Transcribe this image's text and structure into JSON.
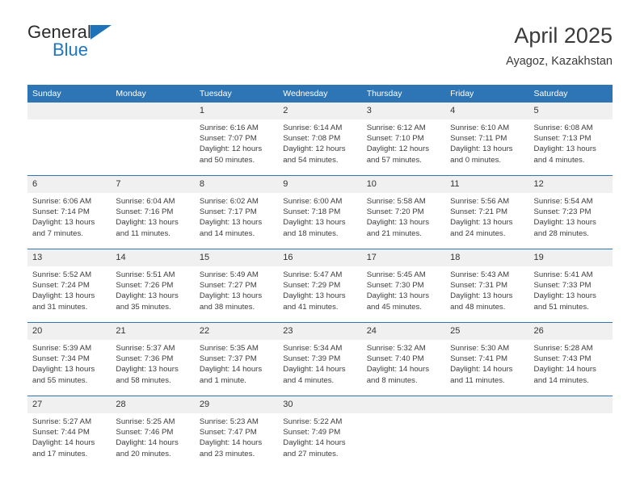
{
  "brand": {
    "line1": "General",
    "line2": "Blue",
    "triangle_color": "#1f72b8"
  },
  "header": {
    "title": "April 2025",
    "subtitle": "Ayagoz, Kazakhstan"
  },
  "theme": {
    "header_blue": "#2e75b6",
    "daynum_gray": "#f0f0f0",
    "text": "#333333"
  },
  "weekday_headers": [
    "Sunday",
    "Monday",
    "Tuesday",
    "Wednesday",
    "Thursday",
    "Friday",
    "Saturday"
  ],
  "weeks": [
    [
      {
        "day": "",
        "lines": []
      },
      {
        "day": "",
        "lines": []
      },
      {
        "day": "1",
        "lines": [
          "Sunrise: 6:16 AM",
          "Sunset: 7:07 PM",
          "Daylight: 12 hours",
          "and 50 minutes."
        ]
      },
      {
        "day": "2",
        "lines": [
          "Sunrise: 6:14 AM",
          "Sunset: 7:08 PM",
          "Daylight: 12 hours",
          "and 54 minutes."
        ]
      },
      {
        "day": "3",
        "lines": [
          "Sunrise: 6:12 AM",
          "Sunset: 7:10 PM",
          "Daylight: 12 hours",
          "and 57 minutes."
        ]
      },
      {
        "day": "4",
        "lines": [
          "Sunrise: 6:10 AM",
          "Sunset: 7:11 PM",
          "Daylight: 13 hours",
          "and 0 minutes."
        ]
      },
      {
        "day": "5",
        "lines": [
          "Sunrise: 6:08 AM",
          "Sunset: 7:13 PM",
          "Daylight: 13 hours",
          "and 4 minutes."
        ]
      }
    ],
    [
      {
        "day": "6",
        "lines": [
          "Sunrise: 6:06 AM",
          "Sunset: 7:14 PM",
          "Daylight: 13 hours",
          "and 7 minutes."
        ]
      },
      {
        "day": "7",
        "lines": [
          "Sunrise: 6:04 AM",
          "Sunset: 7:16 PM",
          "Daylight: 13 hours",
          "and 11 minutes."
        ]
      },
      {
        "day": "8",
        "lines": [
          "Sunrise: 6:02 AM",
          "Sunset: 7:17 PM",
          "Daylight: 13 hours",
          "and 14 minutes."
        ]
      },
      {
        "day": "9",
        "lines": [
          "Sunrise: 6:00 AM",
          "Sunset: 7:18 PM",
          "Daylight: 13 hours",
          "and 18 minutes."
        ]
      },
      {
        "day": "10",
        "lines": [
          "Sunrise: 5:58 AM",
          "Sunset: 7:20 PM",
          "Daylight: 13 hours",
          "and 21 minutes."
        ]
      },
      {
        "day": "11",
        "lines": [
          "Sunrise: 5:56 AM",
          "Sunset: 7:21 PM",
          "Daylight: 13 hours",
          "and 24 minutes."
        ]
      },
      {
        "day": "12",
        "lines": [
          "Sunrise: 5:54 AM",
          "Sunset: 7:23 PM",
          "Daylight: 13 hours",
          "and 28 minutes."
        ]
      }
    ],
    [
      {
        "day": "13",
        "lines": [
          "Sunrise: 5:52 AM",
          "Sunset: 7:24 PM",
          "Daylight: 13 hours",
          "and 31 minutes."
        ]
      },
      {
        "day": "14",
        "lines": [
          "Sunrise: 5:51 AM",
          "Sunset: 7:26 PM",
          "Daylight: 13 hours",
          "and 35 minutes."
        ]
      },
      {
        "day": "15",
        "lines": [
          "Sunrise: 5:49 AM",
          "Sunset: 7:27 PM",
          "Daylight: 13 hours",
          "and 38 minutes."
        ]
      },
      {
        "day": "16",
        "lines": [
          "Sunrise: 5:47 AM",
          "Sunset: 7:29 PM",
          "Daylight: 13 hours",
          "and 41 minutes."
        ]
      },
      {
        "day": "17",
        "lines": [
          "Sunrise: 5:45 AM",
          "Sunset: 7:30 PM",
          "Daylight: 13 hours",
          "and 45 minutes."
        ]
      },
      {
        "day": "18",
        "lines": [
          "Sunrise: 5:43 AM",
          "Sunset: 7:31 PM",
          "Daylight: 13 hours",
          "and 48 minutes."
        ]
      },
      {
        "day": "19",
        "lines": [
          "Sunrise: 5:41 AM",
          "Sunset: 7:33 PM",
          "Daylight: 13 hours",
          "and 51 minutes."
        ]
      }
    ],
    [
      {
        "day": "20",
        "lines": [
          "Sunrise: 5:39 AM",
          "Sunset: 7:34 PM",
          "Daylight: 13 hours",
          "and 55 minutes."
        ]
      },
      {
        "day": "21",
        "lines": [
          "Sunrise: 5:37 AM",
          "Sunset: 7:36 PM",
          "Daylight: 13 hours",
          "and 58 minutes."
        ]
      },
      {
        "day": "22",
        "lines": [
          "Sunrise: 5:35 AM",
          "Sunset: 7:37 PM",
          "Daylight: 14 hours",
          "and 1 minute."
        ]
      },
      {
        "day": "23",
        "lines": [
          "Sunrise: 5:34 AM",
          "Sunset: 7:39 PM",
          "Daylight: 14 hours",
          "and 4 minutes."
        ]
      },
      {
        "day": "24",
        "lines": [
          "Sunrise: 5:32 AM",
          "Sunset: 7:40 PM",
          "Daylight: 14 hours",
          "and 8 minutes."
        ]
      },
      {
        "day": "25",
        "lines": [
          "Sunrise: 5:30 AM",
          "Sunset: 7:41 PM",
          "Daylight: 14 hours",
          "and 11 minutes."
        ]
      },
      {
        "day": "26",
        "lines": [
          "Sunrise: 5:28 AM",
          "Sunset: 7:43 PM",
          "Daylight: 14 hours",
          "and 14 minutes."
        ]
      }
    ],
    [
      {
        "day": "27",
        "lines": [
          "Sunrise: 5:27 AM",
          "Sunset: 7:44 PM",
          "Daylight: 14 hours",
          "and 17 minutes."
        ]
      },
      {
        "day": "28",
        "lines": [
          "Sunrise: 5:25 AM",
          "Sunset: 7:46 PM",
          "Daylight: 14 hours",
          "and 20 minutes."
        ]
      },
      {
        "day": "29",
        "lines": [
          "Sunrise: 5:23 AM",
          "Sunset: 7:47 PM",
          "Daylight: 14 hours",
          "and 23 minutes."
        ]
      },
      {
        "day": "30",
        "lines": [
          "Sunrise: 5:22 AM",
          "Sunset: 7:49 PM",
          "Daylight: 14 hours",
          "and 27 minutes."
        ]
      },
      {
        "day": "",
        "lines": []
      },
      {
        "day": "",
        "lines": []
      },
      {
        "day": "",
        "lines": []
      }
    ]
  ]
}
